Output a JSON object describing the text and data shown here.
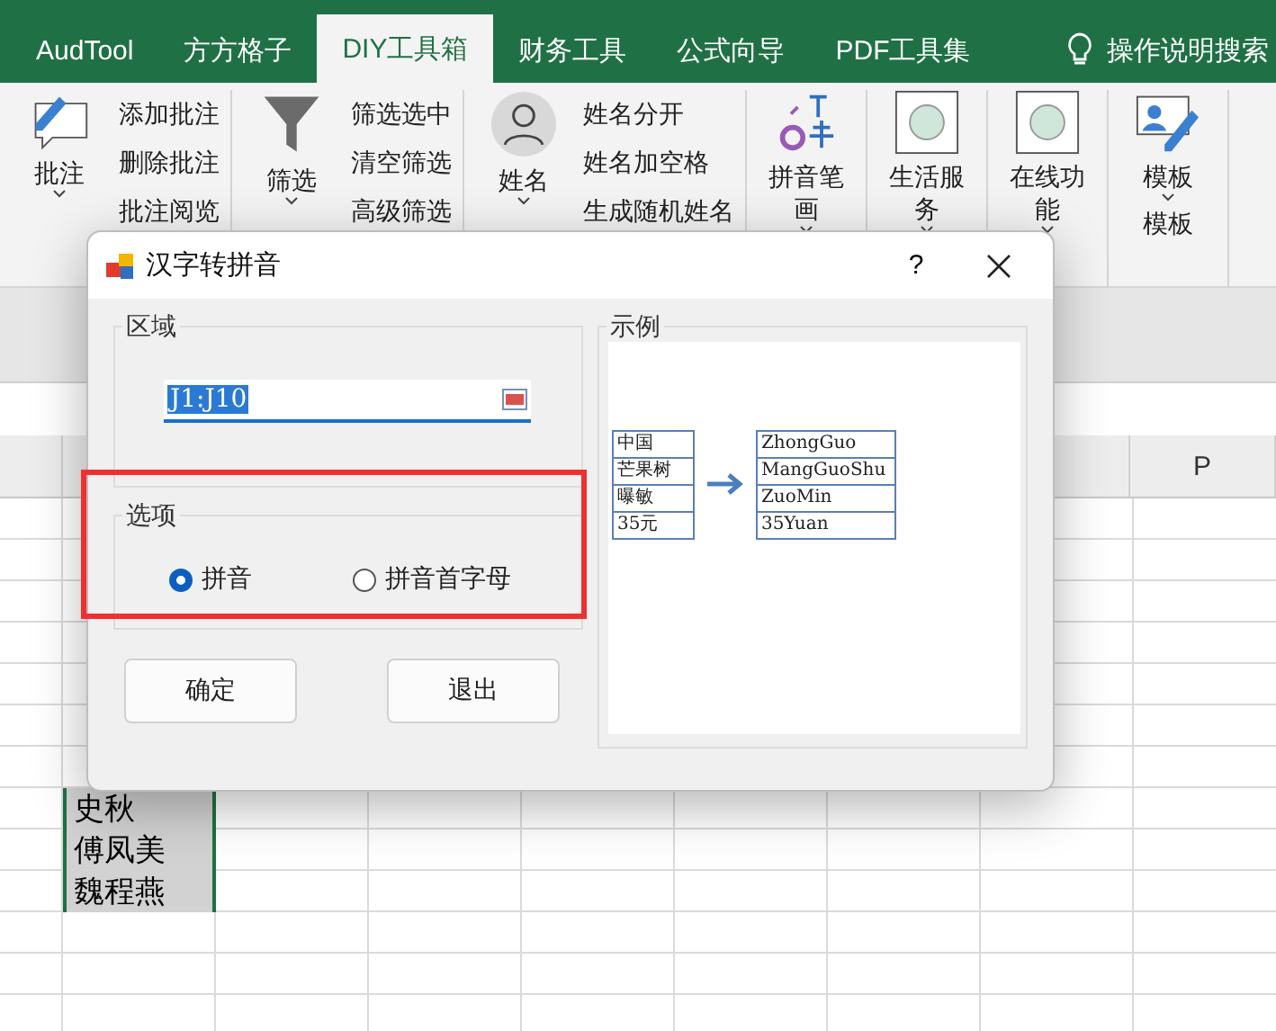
{
  "ribbon_tabs": [
    {
      "label": "AudTool",
      "selected": false
    },
    {
      "label": "方方格子",
      "selected": false
    },
    {
      "label": "DIY工具箱",
      "selected": true
    },
    {
      "label": "财务工具",
      "selected": false
    },
    {
      "label": "公式向导",
      "selected": false
    },
    {
      "label": "PDF工具集",
      "selected": false
    }
  ],
  "search_hint": "操作说明搜索",
  "ribbon_groups": [
    {
      "kind": "comment",
      "label": "批注",
      "items": [
        "添加批注",
        "删除批注",
        "批注阅览"
      ]
    },
    {
      "kind": "filter",
      "label": "筛选",
      "items": [
        "筛选选中",
        "清空筛选",
        "高级筛选"
      ]
    },
    {
      "kind": "person",
      "label": "姓名",
      "items": [
        "姓名分开",
        "姓名加空格",
        "生成随机姓名"
      ]
    },
    {
      "kind": "pinyin",
      "label": "拼音笔画"
    },
    {
      "kind": "circle",
      "label": "生活服务"
    },
    {
      "kind": "circle",
      "label": "在线功能"
    },
    {
      "kind": "template",
      "label": "模板",
      "footer": "模板"
    }
  ],
  "dialog": {
    "title": "汉字转拼音",
    "help": "?",
    "range_group": {
      "title": "区域",
      "value": "J1:J10"
    },
    "options_group": {
      "title": "选项",
      "options": [
        {
          "label": "拼音",
          "selected": true
        },
        {
          "label": "拼音首字母",
          "selected": false
        }
      ]
    },
    "buttons": [
      "确定",
      "退出"
    ],
    "example": {
      "title": "示例",
      "input": [
        "中国",
        "芒果树",
        "曝敏",
        "35元"
      ],
      "output": [
        "ZhongGuo",
        "MangGuoShu",
        "ZuoMin",
        "35Yuan"
      ]
    }
  },
  "sheet": {
    "column_headers": [
      "P"
    ],
    "cells": [
      "史秋",
      "傅凤美",
      "魏程燕"
    ]
  }
}
